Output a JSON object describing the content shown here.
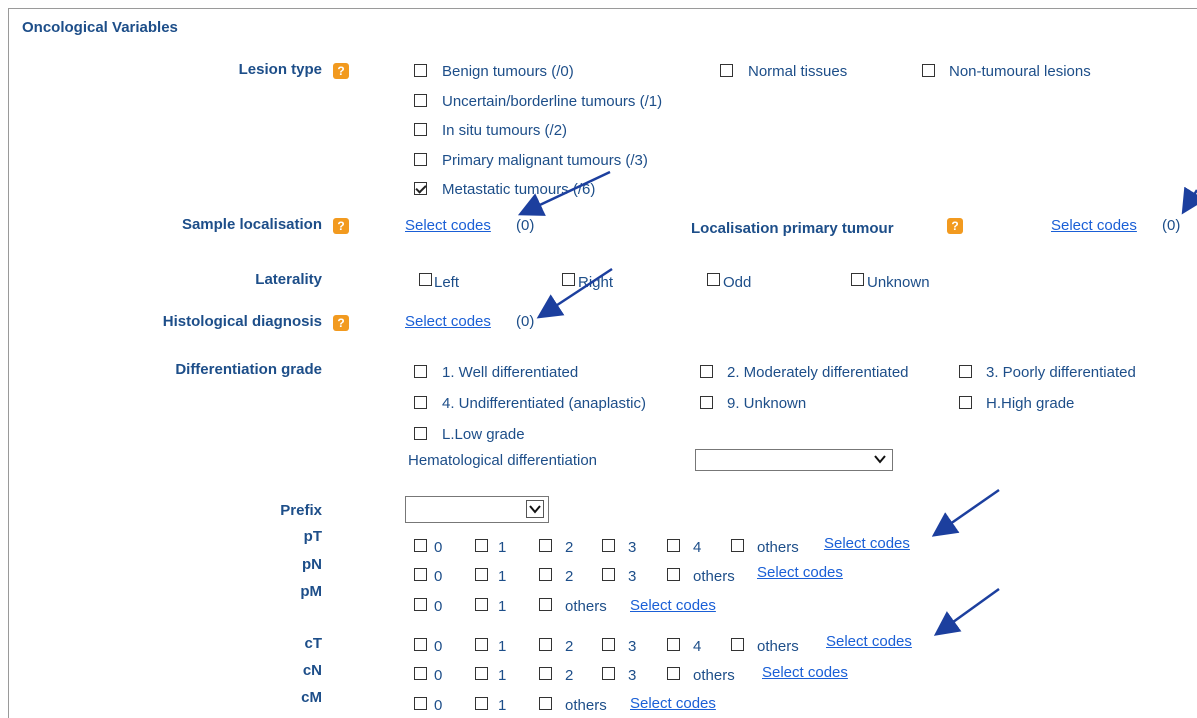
{
  "section_title": "Oncological Variables",
  "help_icon_text": "?",
  "lesion_type": {
    "label": "Lesion type",
    "options": [
      {
        "label": "Benign tumours (/0)",
        "checked": false
      },
      {
        "label": "Normal tissues",
        "checked": false
      },
      {
        "label": "Non-tumoural lesions",
        "checked": false
      },
      {
        "label": "Uncertain/borderline tumours (/1)",
        "checked": false
      },
      {
        "label": "In situ tumours (/2)",
        "checked": false
      },
      {
        "label": "Primary malignant tumours (/3)",
        "checked": false
      },
      {
        "label": "Metastatic tumours (/6)",
        "checked": true
      }
    ]
  },
  "sample_localisation": {
    "label": "Sample localisation",
    "link": "Select codes",
    "count": "(0)"
  },
  "localisation_primary": {
    "label": "Localisation primary tumour",
    "link": "Select codes",
    "count": "(0)"
  },
  "laterality": {
    "label": "Laterality",
    "options": [
      "Left",
      "Right",
      "Odd",
      "Unknown"
    ]
  },
  "histological": {
    "label": "Histological diagnosis",
    "link": "Select codes",
    "count": "(0)"
  },
  "differentiation": {
    "label": "Differentiation grade",
    "options": [
      "1. Well differentiated",
      "2. Moderately differentiated",
      "3. Poorly differentiated",
      "4. Undifferentiated (anaplastic)",
      "9. Unknown",
      "H.High grade",
      "L.Low grade"
    ],
    "hematological_label": "Hematological differentiation",
    "hematological_value": ""
  },
  "tnm": {
    "prefix_label": "Prefix",
    "prefix_value": "",
    "select_link": "Select codes",
    "rows": {
      "pT": {
        "label": "pT",
        "options": [
          "0",
          "1",
          "2",
          "3",
          "4",
          "others"
        ]
      },
      "pN": {
        "label": "pN",
        "options": [
          "0",
          "1",
          "2",
          "3",
          "others"
        ]
      },
      "pM": {
        "label": "pM",
        "options": [
          "0",
          "1",
          "others"
        ]
      },
      "cT": {
        "label": "cT",
        "options": [
          "0",
          "1",
          "2",
          "3",
          "4",
          "others"
        ]
      },
      "cN": {
        "label": "cN",
        "options": [
          "0",
          "1",
          "2",
          "3",
          "others"
        ]
      },
      "cM": {
        "label": "cM",
        "options": [
          "0",
          "1",
          "others"
        ]
      }
    }
  },
  "colors": {
    "label": "#1d4e89",
    "link": "#1a5fd6",
    "help": "#f29a1f",
    "arrow": "#1c3f9e"
  }
}
